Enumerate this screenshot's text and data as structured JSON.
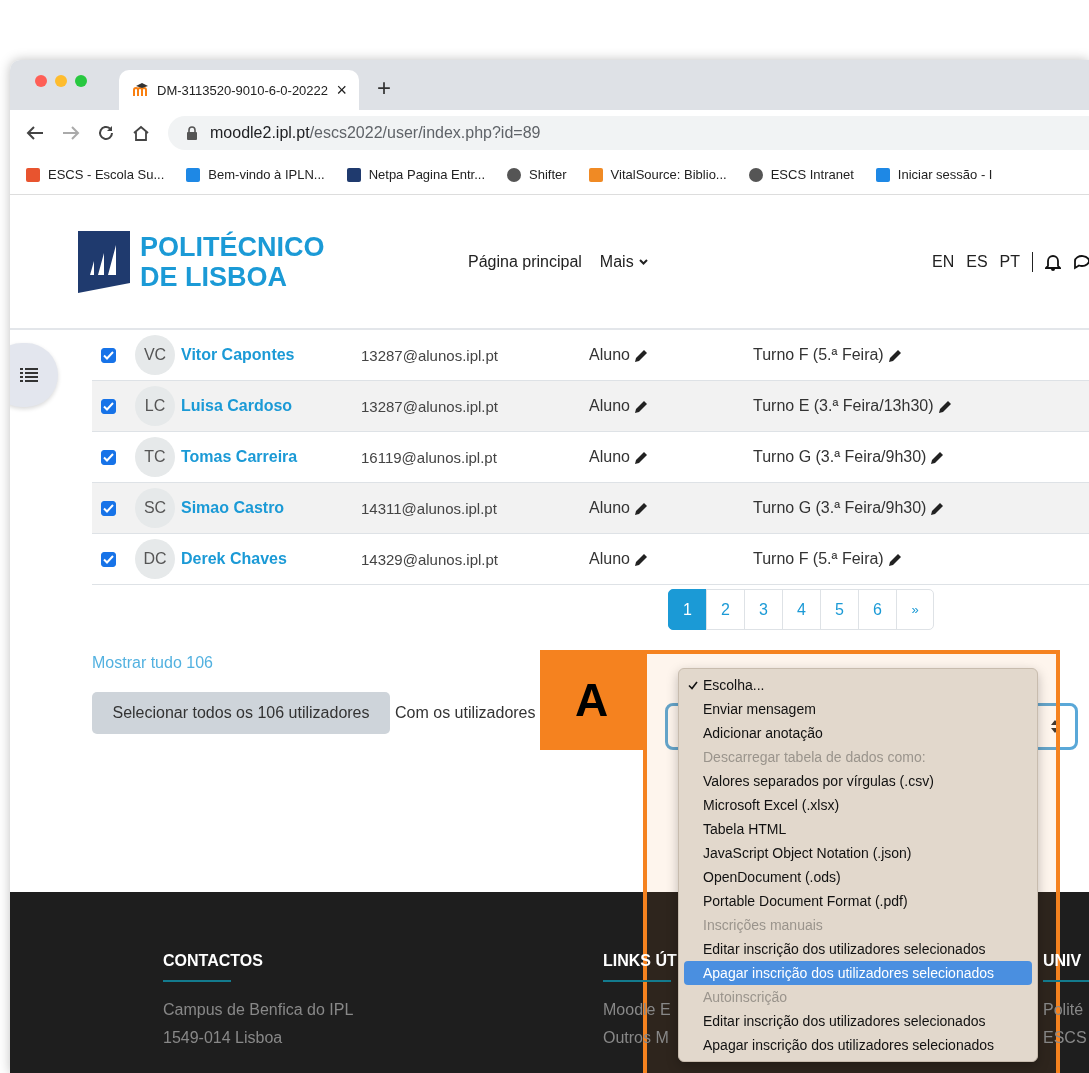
{
  "browser": {
    "tab": {
      "title": "DM-3113520-9010-6-0-20222",
      "close": "×"
    },
    "new_tab": "+",
    "address": {
      "host": "moodle2.ipl.pt",
      "path": "/escs2022/user/index.php?id=89"
    },
    "bookmarks": [
      "ESCS - Escola Su...",
      "Bem-vindo à IPLN...",
      "Netpa Pagina Entr...",
      "Shifter",
      "VitalSource: Biblio...",
      "ESCS Intranet",
      "Iniciar sessão - I"
    ]
  },
  "header": {
    "logo": [
      "POLITÉCNICO",
      "DE LISBOA"
    ],
    "nav": [
      "Página principal",
      "Mais"
    ],
    "languages": [
      "EN",
      "ES",
      "PT"
    ]
  },
  "rows": [
    {
      "initials": "VC",
      "name": "Vitor Capontes",
      "email": "13287@alunos.ipl.pt",
      "role": "Aluno",
      "group": "Turno F (5.ª Feira)",
      "checked": true
    },
    {
      "initials": "LC",
      "name": "Luisa Cardoso",
      "email": "13287@alunos.ipl.pt",
      "role": "Aluno",
      "group": "Turno E (3.ª Feira/13h30)",
      "checked": true
    },
    {
      "initials": "TC",
      "name": "Tomas Carreira",
      "email": "16119@alunos.ipl.pt",
      "role": "Aluno",
      "group": "Turno G (3.ª Feira/9h30)",
      "checked": true
    },
    {
      "initials": "SC",
      "name": "Simao Castro",
      "email": "14311@alunos.ipl.pt",
      "role": "Aluno",
      "group": "Turno G (3.ª Feira/9h30)",
      "checked": true
    },
    {
      "initials": "DC",
      "name": "Derek Chaves",
      "email": "14329@alunos.ipl.pt",
      "role": "Aluno",
      "group": "Turno F (5.ª Feira)",
      "checked": true
    }
  ],
  "pagination": {
    "pages": [
      {
        "label": "1",
        "selected": true
      },
      {
        "label": "2",
        "selected": false
      },
      {
        "label": "3",
        "selected": false
      },
      {
        "label": "4",
        "selected": false
      },
      {
        "label": "5",
        "selected": false
      },
      {
        "label": "6",
        "selected": false
      }
    ],
    "next": "»"
  },
  "show_all": "Mostrar tudo 106",
  "select_all_button": "Selecionar todos os 106 utilizadores",
  "with_users_label": "Com os utilizadores",
  "menu": [
    {
      "kind": "option",
      "label": "Escolha...",
      "selected": true,
      "highlighted": false
    },
    {
      "kind": "option",
      "label": "Enviar mensagem",
      "selected": false,
      "highlighted": false
    },
    {
      "kind": "option",
      "label": "Adicionar anotação",
      "selected": false,
      "highlighted": false
    },
    {
      "kind": "group",
      "label": "Descarregar tabela de dados como:",
      "children": [
        {
          "label": "Valores separados por vírgulas (.csv)",
          "selected": false,
          "highlighted": false
        },
        {
          "label": "Microsoft Excel (.xlsx)",
          "selected": false,
          "highlighted": false
        },
        {
          "label": "Tabela HTML",
          "selected": false,
          "highlighted": false
        },
        {
          "label": "JavaScript Object Notation (.json)",
          "selected": false,
          "highlighted": false
        },
        {
          "label": "OpenDocument (.ods)",
          "selected": false,
          "highlighted": false
        },
        {
          "label": "Portable Document Format (.pdf)",
          "selected": false,
          "highlighted": false
        }
      ]
    },
    {
      "kind": "group",
      "label": "Inscrições manuais",
      "children": [
        {
          "label": "Editar inscrição dos utilizadores selecionados",
          "selected": false,
          "highlighted": false
        },
        {
          "label": "Apagar inscrição dos utilizadores selecionados",
          "selected": false,
          "highlighted": true
        }
      ]
    },
    {
      "kind": "group",
      "label": "Autoinscrição",
      "children": [
        {
          "label": "Editar inscrição dos utilizadores selecionados",
          "selected": false,
          "highlighted": false
        },
        {
          "label": "Apagar inscrição dos utilizadores selecionados",
          "selected": false,
          "highlighted": false
        }
      ]
    }
  ],
  "annotation_label": "A",
  "footer": [
    {
      "heading": "CONTACTOS",
      "lines": [
        "Campus de Benfica do IPL",
        "1549-014 Lisboa"
      ]
    },
    {
      "heading": "LINKS ÚT",
      "lines": [
        "Moodle E",
        "Outros M"
      ]
    },
    {
      "heading": "UNIV",
      "lines": [
        "Polité",
        "ESCS"
      ]
    }
  ]
}
